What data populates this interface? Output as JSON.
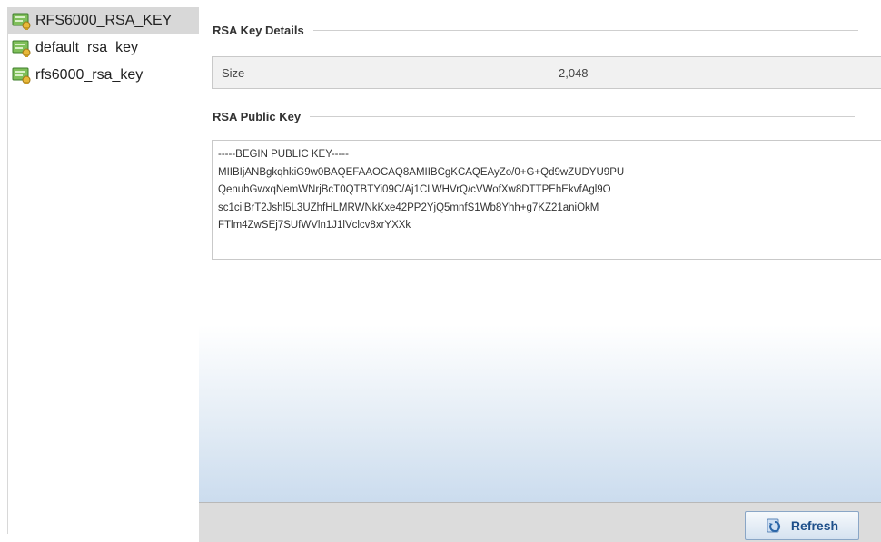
{
  "sidebar": {
    "items": [
      {
        "label": "RFS6000_RSA_KEY",
        "icon": "key-certificate-icon",
        "selected": true
      },
      {
        "label": "default_rsa_key",
        "icon": "key-certificate-icon",
        "selected": false
      },
      {
        "label": "rfs6000_rsa_key",
        "icon": "key-certificate-icon",
        "selected": false
      }
    ]
  },
  "details": {
    "title": "RSA Key Details",
    "size_label": "Size",
    "size_value": "2,048"
  },
  "public_key": {
    "title": "RSA Public Key",
    "lines": [
      "-----BEGIN PUBLIC KEY-----",
      "MIIBIjANBgkqhkiG9w0BAQEFAAOCAQ8AMIIBCgKCAQEAyZo/0+G+Qd9wZUDYU9PU",
      "QenuhGwxqNemWNrjBcT0QTBTYi09C/Aj1CLWHVrQ/cVWofXw8DTTPEhEkvfAgl9O",
      "sc1cilBrT2Jshl5L3UZhfHLMRWNkKxe42PP2YjQ5mnfS1Wb8Yhh+g7KZ21aniOkM",
      "FTlm4ZwSEj7SUfWVln1J1lVclcv8xrYXXk"
    ]
  },
  "footer": {
    "refresh_label": "Refresh",
    "refresh_icon": "refresh-icon"
  },
  "colors": {
    "selected_bg": "#d8d8d8",
    "button_text": "#1d4f8a",
    "panel_gradient_bottom": "#cbdcee"
  }
}
